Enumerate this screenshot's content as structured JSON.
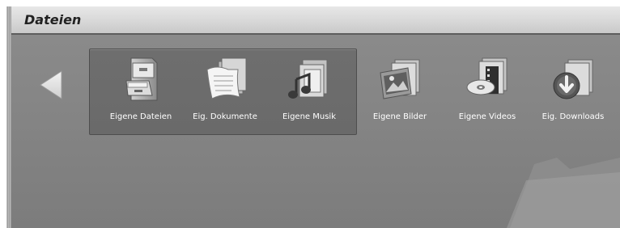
{
  "window": {
    "title": "Dateien"
  },
  "navigation": {
    "back_icon": "triangle-left-icon"
  },
  "tiles": [
    {
      "label": "Eigene Dateien",
      "icon": "file-cabinet-icon"
    },
    {
      "label": "Eig. Dokumente",
      "icon": "documents-icon"
    },
    {
      "label": "Eigene Musik",
      "icon": "music-folder-icon"
    },
    {
      "label": "Eigene Bilder",
      "icon": "pictures-folder-icon"
    },
    {
      "label": "Eigene Videos",
      "icon": "videos-folder-icon"
    },
    {
      "label": "Eig. Downloads",
      "icon": "downloads-folder-icon"
    }
  ],
  "colors": {
    "background": "#868686",
    "header": "#d8d8d8",
    "panel": "#6c6c6c",
    "text": "#ffffff"
  }
}
